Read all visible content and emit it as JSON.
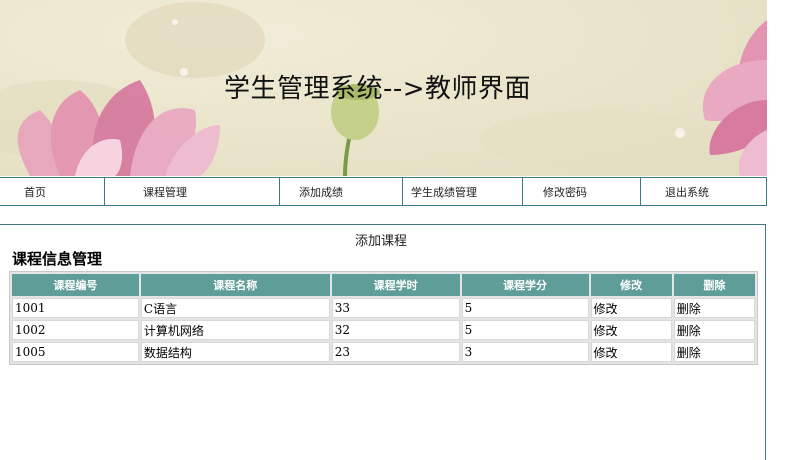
{
  "banner": {
    "title": "学生管理系统-->教师界面"
  },
  "nav": {
    "items": [
      {
        "label": "首页"
      },
      {
        "label": "课程管理"
      },
      {
        "label": "添加成绩"
      },
      {
        "label": "学生成绩管理"
      },
      {
        "label": "修改密码"
      },
      {
        "label": "退出系统"
      }
    ]
  },
  "main": {
    "add_link": "添加课程",
    "section_title": "课程信息管理",
    "table": {
      "headers": [
        "课程编号",
        "课程名称",
        "课程学时",
        "课程学分",
        "修改",
        "删除"
      ],
      "rows": [
        {
          "id": "1001",
          "name": "C语言",
          "hours": "33",
          "credits": "5",
          "edit": "修改",
          "del": "删除"
        },
        {
          "id": "1002",
          "name": "计算机网络",
          "hours": "32",
          "credits": "5",
          "edit": "修改",
          "del": "删除"
        },
        {
          "id": "1005",
          "name": "数据结构",
          "hours": "23",
          "credits": "3",
          "edit": "修改",
          "del": "删除"
        }
      ]
    }
  },
  "colors": {
    "accent": "#3d7a84",
    "table_header": "#5f9d99",
    "banner_bg": "#ebe5cc"
  }
}
